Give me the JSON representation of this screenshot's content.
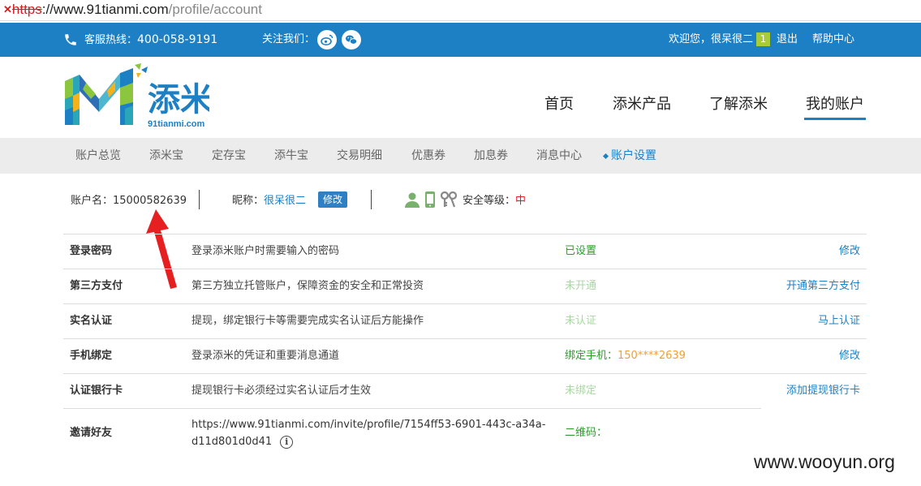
{
  "browser": {
    "url_scheme": "https",
    "url_host": "://www.91tianmi.com",
    "url_path": "/profile/account"
  },
  "topbar": {
    "hotline_label": "客服热线：",
    "hotline_number": "400-058-9191",
    "follow_label": "关注我们：",
    "welcome": "欢迎您，很呆很二",
    "message_count": "1",
    "logout": "退出",
    "help": "帮助中心"
  },
  "brand": {
    "name": "添米",
    "domain": "91tianmi.com"
  },
  "main_nav": [
    "首页",
    "添米产品",
    "了解添米",
    "我的账户"
  ],
  "main_nav_active": "我的账户",
  "sub_nav": [
    "账户总览",
    "添米宝",
    "定存宝",
    "添牛宝",
    "交易明细",
    "优惠券",
    "加息券",
    "消息中心",
    "账户设置"
  ],
  "sub_nav_active": "账户设置",
  "account": {
    "username_label": "账户名：",
    "username": "15000582639",
    "nickname_label": "昵称：",
    "nickname": "很呆很二",
    "edit_label": "修改",
    "security_label": "安全等级：",
    "security_level": "中"
  },
  "settings": [
    {
      "name": "登录密码",
      "desc": "登录添米账户时需要输入的密码",
      "status": "已设置",
      "action": "修改"
    },
    {
      "name": "第三方支付",
      "desc": "第三方独立托管账户，保障资金的安全和正常投资",
      "status": "未开通",
      "action": "开通第三方支付"
    },
    {
      "name": "实名认证",
      "desc": "提现，绑定银行卡等需要完成实名认证后方能操作",
      "status": "未认证",
      "action": "马上认证"
    },
    {
      "name": "手机绑定",
      "desc": "登录添米的凭证和重要消息通道",
      "status_label": "绑定手机：",
      "status": "150****2639",
      "action": "修改"
    },
    {
      "name": "认证银行卡",
      "desc": "提现银行卡必须经过实名认证后才生效",
      "status": "未绑定",
      "action": "添加提现银行卡"
    },
    {
      "name": "邀请好友",
      "desc_line1": "https://www.91tianmi.com/invite/profile/7154ff53-6901-443c-a34a-",
      "desc_line2": "d11d801d0d41",
      "status": "二维码："
    }
  ],
  "watermark": "www.wooyun.org",
  "colors": {
    "brand_blue": "#1d80c4",
    "ok_green": "#2f9a2f",
    "pending_green": "#a9d7a3",
    "phone_orange": "#f0a030",
    "level_red": "#e02020",
    "badge_green": "#a6cc3a"
  }
}
